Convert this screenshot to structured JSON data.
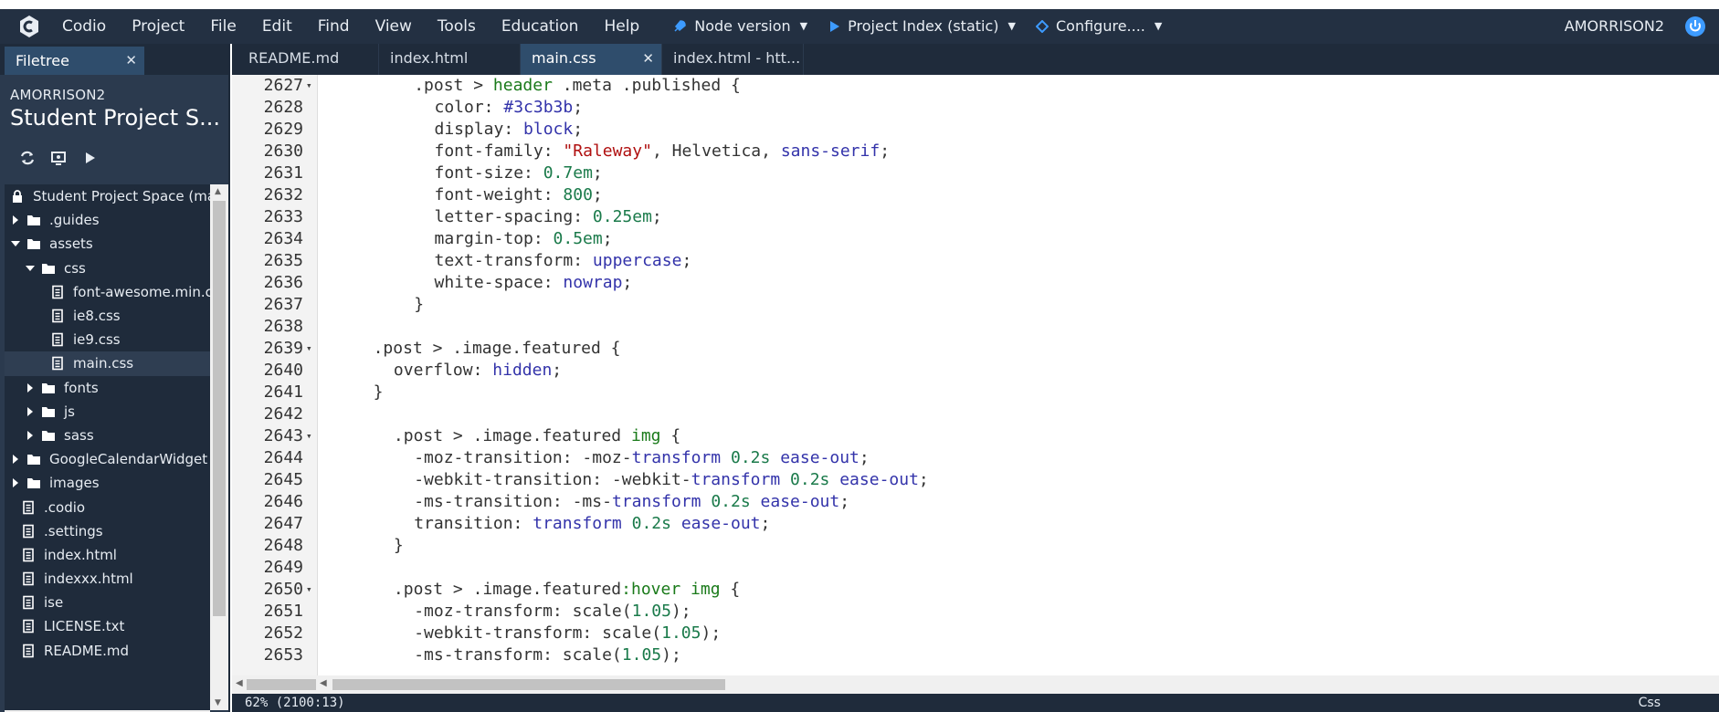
{
  "menubar": {
    "items": [
      "Codio",
      "Project",
      "File",
      "Edit",
      "Find",
      "View",
      "Tools",
      "Education",
      "Help"
    ],
    "node_version": "Node version",
    "project_index": "Project Index (static)",
    "configure": "Configure....",
    "user": "AMORRISON2",
    "colors": {
      "bar": "#233042",
      "accent": "#3d9bff"
    }
  },
  "filetree": {
    "tab_label": "Filetree",
    "user": "AMORRISON2",
    "project": "Student Project S...",
    "actions": [
      "refresh-icon",
      "preview-icon",
      "run-icon"
    ],
    "items": [
      {
        "label": "Student Project Space (mast",
        "type": "lock",
        "level": 0
      },
      {
        "label": ".guides",
        "type": "folder",
        "level": 0,
        "state": "closed"
      },
      {
        "label": "assets",
        "type": "folder",
        "level": 0,
        "state": "open"
      },
      {
        "label": "css",
        "type": "folder",
        "level": 1,
        "state": "open"
      },
      {
        "label": "font-awesome.min.c",
        "type": "file",
        "level": 2
      },
      {
        "label": "ie8.css",
        "type": "file",
        "level": 2
      },
      {
        "label": "ie9.css",
        "type": "file",
        "level": 2
      },
      {
        "label": "main.css",
        "type": "file",
        "level": 2,
        "selected": true
      },
      {
        "label": "fonts",
        "type": "folder",
        "level": 1,
        "state": "closed"
      },
      {
        "label": "js",
        "type": "folder",
        "level": 1,
        "state": "closed"
      },
      {
        "label": "sass",
        "type": "folder",
        "level": 1,
        "state": "closed"
      },
      {
        "label": "GoogleCalendarWidget",
        "type": "folder",
        "level": 0,
        "state": "closed"
      },
      {
        "label": "images",
        "type": "folder",
        "level": 0,
        "state": "closed"
      },
      {
        "label": ".codio",
        "type": "file",
        "level": 0
      },
      {
        "label": ".settings",
        "type": "file",
        "level": 0
      },
      {
        "label": "index.html",
        "type": "file",
        "level": 0
      },
      {
        "label": "indexxx.html",
        "type": "file",
        "level": 0
      },
      {
        "label": "ise",
        "type": "file",
        "level": 0
      },
      {
        "label": "LICENSE.txt",
        "type": "file",
        "level": 0
      },
      {
        "label": "README.md",
        "type": "file",
        "level": 0
      }
    ]
  },
  "editor": {
    "tabs": [
      {
        "label": "README.md",
        "active": false
      },
      {
        "label": "index.html",
        "active": false
      },
      {
        "label": "main.css",
        "active": true
      },
      {
        "label": "index.html - htt...",
        "active": false
      }
    ],
    "lines": [
      {
        "n": "2627",
        "fold": true,
        "indent": 4,
        "tokens": [
          [
            ".post > ",
            "sel"
          ],
          [
            "header",
            "tag"
          ],
          [
            " .meta .published {",
            "sel"
          ]
        ]
      },
      {
        "n": "2628",
        "indent": 5,
        "tokens": [
          [
            "color: ",
            "sel"
          ],
          [
            "#3c3b3b",
            "kw"
          ],
          [
            ";",
            "sel"
          ]
        ]
      },
      {
        "n": "2629",
        "indent": 5,
        "tokens": [
          [
            "display: ",
            "sel"
          ],
          [
            "block",
            "kw"
          ],
          [
            ";",
            "sel"
          ]
        ]
      },
      {
        "n": "2630",
        "indent": 5,
        "tokens": [
          [
            "font-family: ",
            "sel"
          ],
          [
            "\"Raleway\"",
            "str"
          ],
          [
            ", Helvetica, ",
            "sel"
          ],
          [
            "sans-serif",
            "kw"
          ],
          [
            ";",
            "sel"
          ]
        ]
      },
      {
        "n": "2631",
        "indent": 5,
        "tokens": [
          [
            "font-size: ",
            "sel"
          ],
          [
            "0.7em",
            "num"
          ],
          [
            ";",
            "sel"
          ]
        ]
      },
      {
        "n": "2632",
        "indent": 5,
        "tokens": [
          [
            "font-weight: ",
            "sel"
          ],
          [
            "800",
            "num"
          ],
          [
            ";",
            "sel"
          ]
        ]
      },
      {
        "n": "2633",
        "indent": 5,
        "tokens": [
          [
            "letter-spacing: ",
            "sel"
          ],
          [
            "0.25em",
            "num"
          ],
          [
            ";",
            "sel"
          ]
        ]
      },
      {
        "n": "2634",
        "indent": 5,
        "tokens": [
          [
            "margin-top: ",
            "sel"
          ],
          [
            "0.5em",
            "num"
          ],
          [
            ";",
            "sel"
          ]
        ]
      },
      {
        "n": "2635",
        "indent": 5,
        "tokens": [
          [
            "text-transform: ",
            "sel"
          ],
          [
            "uppercase",
            "kw"
          ],
          [
            ";",
            "sel"
          ]
        ]
      },
      {
        "n": "2636",
        "indent": 5,
        "tokens": [
          [
            "white-space: ",
            "sel"
          ],
          [
            "nowrap",
            "kw"
          ],
          [
            ";",
            "sel"
          ]
        ]
      },
      {
        "n": "2637",
        "indent": 4,
        "tokens": [
          [
            "}",
            "sel"
          ]
        ]
      },
      {
        "n": "2638",
        "indent": 0,
        "tokens": []
      },
      {
        "n": "2639",
        "fold": true,
        "indent": 2,
        "tokens": [
          [
            ".post > .image.featured {",
            "sel"
          ]
        ]
      },
      {
        "n": "2640",
        "indent": 3,
        "tokens": [
          [
            "overflow: ",
            "sel"
          ],
          [
            "hidden",
            "kw"
          ],
          [
            ";",
            "sel"
          ]
        ]
      },
      {
        "n": "2641",
        "indent": 2,
        "tokens": [
          [
            "}",
            "sel"
          ]
        ]
      },
      {
        "n": "2642",
        "indent": 0,
        "tokens": []
      },
      {
        "n": "2643",
        "fold": true,
        "indent": 3,
        "tokens": [
          [
            ".post > .image.featured ",
            "sel"
          ],
          [
            "img",
            "tag"
          ],
          [
            " {",
            "sel"
          ]
        ]
      },
      {
        "n": "2644",
        "indent": 4,
        "tokens": [
          [
            "-moz-transition: -moz-",
            "sel"
          ],
          [
            "transform",
            "kw"
          ],
          [
            " ",
            "sel"
          ],
          [
            "0.2s",
            "num"
          ],
          [
            " ",
            "sel"
          ],
          [
            "ease-out",
            "kw"
          ],
          [
            ";",
            "sel"
          ]
        ]
      },
      {
        "n": "2645",
        "indent": 4,
        "tokens": [
          [
            "-webkit-transition: -webkit-",
            "sel"
          ],
          [
            "transform",
            "kw"
          ],
          [
            " ",
            "sel"
          ],
          [
            "0.2s",
            "num"
          ],
          [
            " ",
            "sel"
          ],
          [
            "ease-out",
            "kw"
          ],
          [
            ";",
            "sel"
          ]
        ]
      },
      {
        "n": "2646",
        "indent": 4,
        "tokens": [
          [
            "-ms-transition: -ms-",
            "sel"
          ],
          [
            "transform",
            "kw"
          ],
          [
            " ",
            "sel"
          ],
          [
            "0.2s",
            "num"
          ],
          [
            " ",
            "sel"
          ],
          [
            "ease-out",
            "kw"
          ],
          [
            ";",
            "sel"
          ]
        ]
      },
      {
        "n": "2647",
        "indent": 4,
        "tokens": [
          [
            "transition: ",
            "sel"
          ],
          [
            "transform",
            "kw"
          ],
          [
            " ",
            "sel"
          ],
          [
            "0.2s",
            "num"
          ],
          [
            " ",
            "sel"
          ],
          [
            "ease-out",
            "kw"
          ],
          [
            ";",
            "sel"
          ]
        ]
      },
      {
        "n": "2648",
        "indent": 3,
        "tokens": [
          [
            "}",
            "sel"
          ]
        ]
      },
      {
        "n": "2649",
        "indent": 0,
        "tokens": []
      },
      {
        "n": "2650",
        "fold": true,
        "indent": 3,
        "tokens": [
          [
            ".post > .image.featured",
            "sel"
          ],
          [
            ":hover",
            "tag"
          ],
          [
            " ",
            "sel"
          ],
          [
            "img",
            "tag"
          ],
          [
            " {",
            "sel"
          ]
        ]
      },
      {
        "n": "2651",
        "indent": 4,
        "tokens": [
          [
            "-moz-transform: scale(",
            "sel"
          ],
          [
            "1.05",
            "num"
          ],
          [
            ");",
            "sel"
          ]
        ]
      },
      {
        "n": "2652",
        "indent": 4,
        "tokens": [
          [
            "-webkit-transform: scale(",
            "sel"
          ],
          [
            "1.05",
            "num"
          ],
          [
            ");",
            "sel"
          ]
        ]
      },
      {
        "n": "2653",
        "indent": 4,
        "tokens": [
          [
            "-ms-transform: scale(",
            "sel"
          ],
          [
            "1.05",
            "num"
          ],
          [
            ");",
            "sel"
          ]
        ]
      }
    ],
    "status": {
      "zoom_pos": "62%  (2100:13)",
      "mode": "Css"
    }
  }
}
